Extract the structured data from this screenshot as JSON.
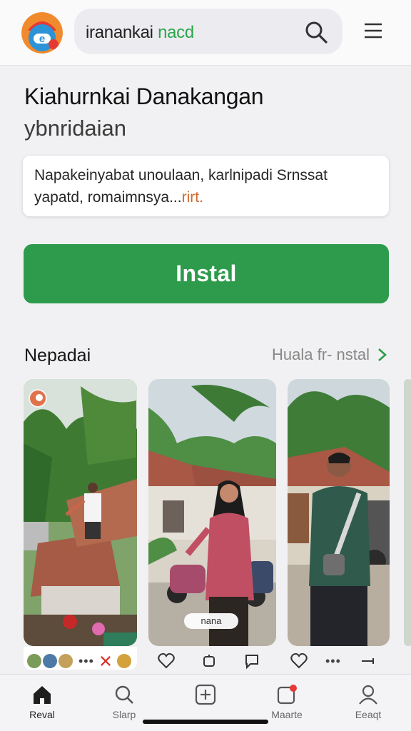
{
  "header": {
    "search_prefix": "iranankai ",
    "search_accent": "nacd",
    "icons": {
      "logo": "app-logo-icon",
      "search": "search-icon",
      "menu": "hamburger-menu-icon"
    }
  },
  "app": {
    "title": "Kiahurnkai Danakangan",
    "subtitle": "ybnridaian",
    "description_line1": "Napakeinyabat unoulaan, karlnipadi Srnssat",
    "description_line2_prefix": "yapatd, romaimnsya...",
    "description_line2_highlight": "rirt.",
    "install_label": "Instal"
  },
  "screenshots": {
    "section_title": "Nepadai",
    "see_all_label": "Huala fr- nstal",
    "caption": "nana"
  },
  "bottom_nav": [
    {
      "label": "Reval",
      "icon": "home-icon",
      "active": true
    },
    {
      "label": "Slarp",
      "icon": "search-icon",
      "active": false
    },
    {
      "label": "",
      "icon": "add-icon",
      "active": false
    },
    {
      "label": "Maarte",
      "icon": "notification-icon",
      "active": false
    },
    {
      "label": "Eeaqt",
      "icon": "profile-icon",
      "active": false
    }
  ],
  "colors": {
    "accent_green": "#2d9b4b",
    "highlight_orange": "#d06a2f"
  }
}
